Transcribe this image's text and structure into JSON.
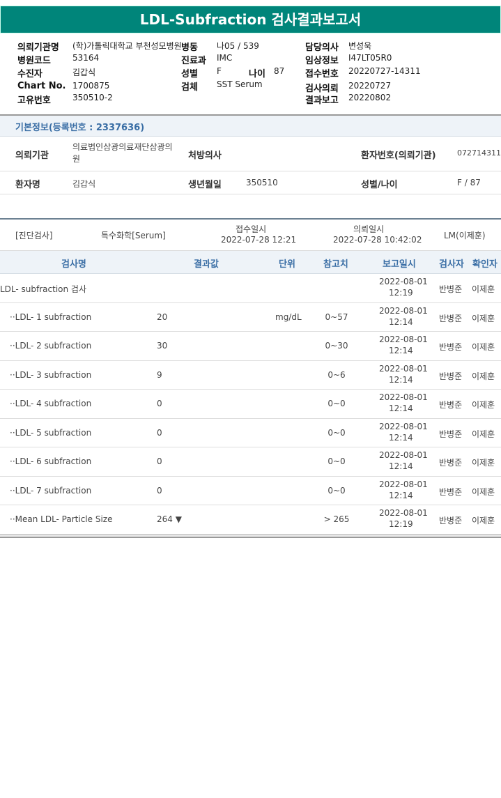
{
  "title": "LDL-Subfraction 검사결과보고서",
  "header": {
    "hospital_label": "의뢰기관명",
    "hospital": "(학)가톨릭대학교 부천성모병원",
    "ward_label": "병동",
    "ward": "나05 / 539",
    "doctor_label": "담당의사",
    "doctor": "변성욱",
    "code_label": "병원코드",
    "code": "53164",
    "dept_label": "진료과",
    "dept": "IMC",
    "clinical_label": "임상정보",
    "clinical": "I47LT05R0",
    "patient_label": "수진자",
    "patient": "김갑식",
    "sex_label": "성별",
    "sex": "F",
    "age_label": "나이",
    "age": "87",
    "receipt_label": "접수번호",
    "receipt": "20220727-14311",
    "chart_label": "Chart No.",
    "chart": "1700875",
    "specimen_label": "검체",
    "specimen": "SST Serum",
    "request_label": "검사의뢰",
    "request": "20220727",
    "uid_label": "고유번호",
    "uid": "350510-2",
    "report_label": "결과보고",
    "report": "20220802"
  },
  "basic": {
    "section_title": "기본정보(등록번호 : 2337636)",
    "inst_label": "의뢰기관",
    "inst": "의료법인삼광의료재단삼광의원",
    "prescriber_label": "처방의사",
    "prescriber": "",
    "pid_label": "환자번호(의뢰기관)",
    "pid": "072714311",
    "name_label": "환자명",
    "name": "김갑식",
    "birth_label": "생년월일",
    "birth": "350510",
    "sexage_label": "성별/나이",
    "sexage": "F / 87"
  },
  "exam": {
    "category": "[진단검사]",
    "type": "특수화학[Serum]",
    "receipt_label": "접수일시",
    "receipt": "2022-07-28 12:21",
    "request_label": "의뢰일시",
    "request": "2022-07-28 10:42:02",
    "lab": "LM(이제훈)"
  },
  "table": {
    "headers": [
      "검사명",
      "결과값",
      "단위",
      "참고치",
      "보고일시",
      "검사자",
      "확인자"
    ],
    "rows": [
      {
        "name": "LDL- subfraction 검사",
        "value": "",
        "unit": "",
        "ref": "",
        "date": "2022-08-01",
        "time": "12:19",
        "tester": "반병준",
        "confirmer": "이제훈"
      },
      {
        "name": "··LDL- 1 subfraction",
        "value": "20",
        "unit": "mg/dL",
        "ref": "0~57",
        "date": "2022-08-01",
        "time": "12:14",
        "tester": "반병준",
        "confirmer": "이제훈"
      },
      {
        "name": "··LDL- 2 subfraction",
        "value": "30",
        "unit": "",
        "ref": "0~30",
        "date": "2022-08-01",
        "time": "12:14",
        "tester": "반병준",
        "confirmer": "이제훈"
      },
      {
        "name": "··LDL- 3 subfraction",
        "value": "9",
        "unit": "",
        "ref": "0~6",
        "date": "2022-08-01",
        "time": "12:14",
        "tester": "반병준",
        "confirmer": "이제훈"
      },
      {
        "name": "··LDL- 4 subfraction",
        "value": "0",
        "unit": "",
        "ref": "0~0",
        "date": "2022-08-01",
        "time": "12:14",
        "tester": "반병준",
        "confirmer": "이제훈"
      },
      {
        "name": "··LDL- 5 subfraction",
        "value": "0",
        "unit": "",
        "ref": "0~0",
        "date": "2022-08-01",
        "time": "12:14",
        "tester": "반병준",
        "confirmer": "이제훈"
      },
      {
        "name": "··LDL- 6 subfraction",
        "value": "0",
        "unit": "",
        "ref": "0~0",
        "date": "2022-08-01",
        "time": "12:14",
        "tester": "반병준",
        "confirmer": "이제훈"
      },
      {
        "name": "··LDL- 7 subfraction",
        "value": "0",
        "unit": "",
        "ref": "0~0",
        "date": "2022-08-01",
        "time": "12:14",
        "tester": "반병준",
        "confirmer": "이제훈"
      },
      {
        "name": "··Mean LDL- Particle Size",
        "value": "264 ▼",
        "unit": "",
        "ref": "> 265",
        "date": "2022-08-01",
        "time": "12:19",
        "tester": "반병준",
        "confirmer": "이제훈"
      }
    ]
  },
  "colors": {
    "title_bg": "#00857a",
    "section_bg": "#eef3f8",
    "header_text": "#3a6ea5"
  }
}
